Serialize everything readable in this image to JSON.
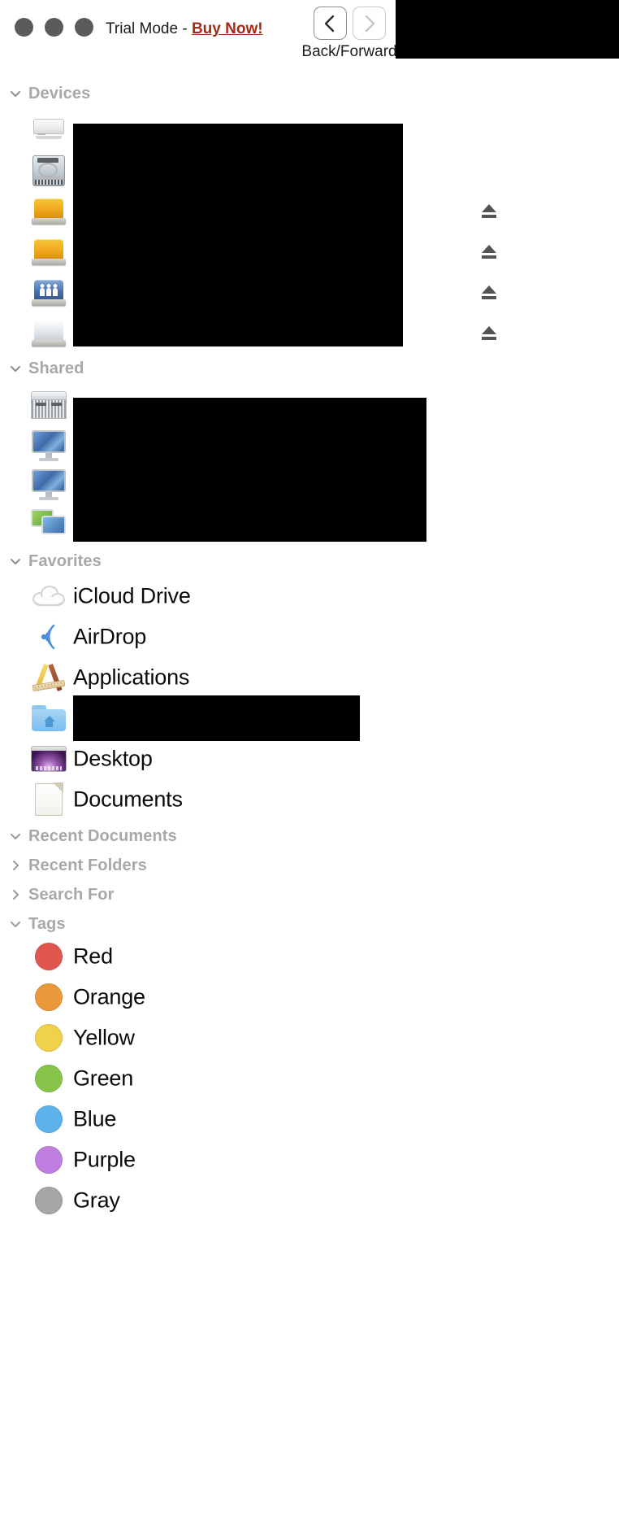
{
  "window": {
    "trial_prefix": "Trial Mode - ",
    "trial_link": "Buy Now!",
    "traffic_lights": [
      "close-button",
      "minimize-button",
      "zoom-button"
    ],
    "title_redacted": true
  },
  "annotation": {
    "back_forward_caption": "Back/Forward",
    "back_icon": "chevron-left-icon",
    "forward_icon": "chevron-right-icon",
    "forward_disabled": true
  },
  "sidebar": {
    "sections": [
      {
        "id": "devices",
        "label": "Devices",
        "expanded": true,
        "chevron": "chevron-down-icon",
        "items": [
          {
            "icon": "airport-base-station-icon",
            "label": "",
            "redacted": true,
            "redact_width": 406,
            "eject": false
          },
          {
            "icon": "internal-hard-disk-icon",
            "label": "",
            "redacted": true,
            "redact_width": 406,
            "eject": false
          },
          {
            "icon": "external-drive-orange-icon",
            "label": "",
            "redacted": true,
            "redact_width": 406,
            "eject": true
          },
          {
            "icon": "external-drive-orange-icon",
            "label": "",
            "redacted": true,
            "redact_width": 406,
            "eject": true
          },
          {
            "icon": "shared-drive-users-icon",
            "label": "",
            "redacted": true,
            "redact_width": 406,
            "eject": true
          },
          {
            "icon": "external-drive-gray-icon",
            "label": "",
            "redacted": true,
            "redact_width": 406,
            "eject": true
          }
        ]
      },
      {
        "id": "shared",
        "label": "Shared",
        "expanded": true,
        "chevron": "chevron-down-icon",
        "items": [
          {
            "icon": "server-icon",
            "label": "",
            "redacted": true,
            "redact_width": 435,
            "eject": false
          },
          {
            "icon": "imac-display-icon",
            "label": "",
            "redacted": true,
            "redact_width": 435,
            "eject": false
          },
          {
            "icon": "imac-display-icon",
            "label": "",
            "redacted": true,
            "redact_width": 435,
            "eject": false
          },
          {
            "icon": "all-network-icon",
            "label": "",
            "redacted": true,
            "redact_width": 435,
            "eject": false
          }
        ]
      },
      {
        "id": "favorites",
        "label": "Favorites",
        "expanded": true,
        "chevron": "chevron-down-icon",
        "items": [
          {
            "icon": "icloud-drive-icon",
            "label": "iCloud Drive",
            "redacted": false,
            "eject": false
          },
          {
            "icon": "airdrop-icon",
            "label": "AirDrop",
            "redacted": false,
            "eject": false
          },
          {
            "icon": "applications-icon",
            "label": "Applications",
            "redacted": false,
            "eject": false
          },
          {
            "icon": "home-folder-icon",
            "label": "",
            "redacted": true,
            "redact_width": 353,
            "eject": false
          },
          {
            "icon": "desktop-icon",
            "label": "Desktop",
            "redacted": false,
            "eject": false
          },
          {
            "icon": "documents-icon",
            "label": "Documents",
            "redacted": false,
            "eject": false
          }
        ]
      },
      {
        "id": "recent-documents",
        "label": "Recent Documents",
        "expanded": true,
        "chevron": "chevron-down-icon",
        "items": []
      },
      {
        "id": "recent-folders",
        "label": "Recent Folders",
        "expanded": false,
        "chevron": "chevron-right-icon",
        "items": []
      },
      {
        "id": "search-for",
        "label": "Search For",
        "expanded": false,
        "chevron": "chevron-right-icon",
        "items": []
      },
      {
        "id": "tags",
        "label": "Tags",
        "expanded": true,
        "chevron": "chevron-down-icon",
        "items": [
          {
            "icon": "tag-swatch-red",
            "label": "Red",
            "color": "#e0564f",
            "redacted": false,
            "eject": false
          },
          {
            "icon": "tag-swatch-orange",
            "label": "Orange",
            "color": "#e9993a",
            "redacted": false,
            "eject": false
          },
          {
            "icon": "tag-swatch-yellow",
            "label": "Yellow",
            "color": "#efd14b",
            "redacted": false,
            "eject": false
          },
          {
            "icon": "tag-swatch-green",
            "label": "Green",
            "color": "#86c44a",
            "redacted": false,
            "eject": false
          },
          {
            "icon": "tag-swatch-blue",
            "label": "Blue",
            "color": "#5cb3ec",
            "redacted": false,
            "eject": false
          },
          {
            "icon": "tag-swatch-purple",
            "label": "Purple",
            "color": "#c07fe0",
            "redacted": false,
            "eject": false
          },
          {
            "icon": "tag-swatch-gray",
            "label": "Gray",
            "color": "#a6a6a6",
            "redacted": false,
            "eject": false
          }
        ]
      }
    ]
  },
  "colors": {
    "section_header": "#a8a8a8",
    "item_label": "#0a0a0a",
    "trial_link": "#a52a14",
    "redaction": "#000000",
    "background": "#ffffff"
  }
}
